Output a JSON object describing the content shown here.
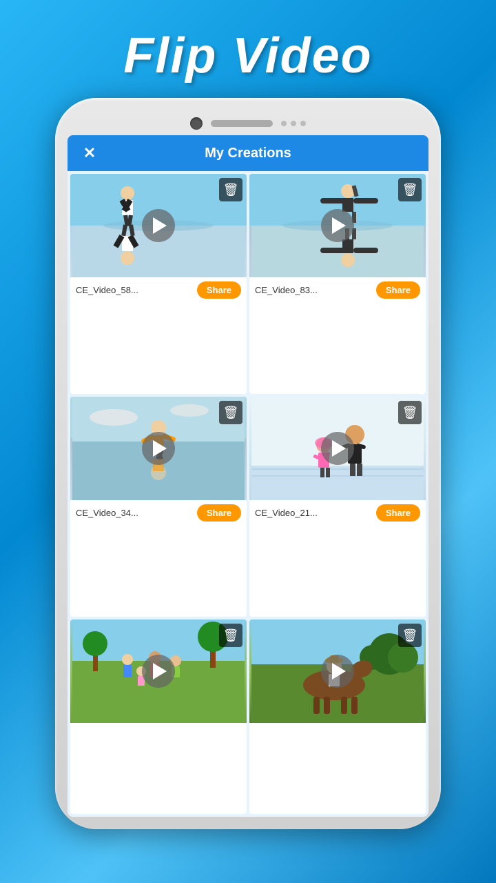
{
  "app": {
    "title": "Flip Video"
  },
  "header": {
    "close_label": "✕",
    "title": "My Creations"
  },
  "videos": [
    {
      "id": "v1",
      "name": "CE_Video_58...",
      "share_label": "Share",
      "thumb_type": "skate1"
    },
    {
      "id": "v2",
      "name": "CE_Video_83...",
      "share_label": "Share",
      "thumb_type": "skate2"
    },
    {
      "id": "v3",
      "name": "CE_Video_34...",
      "share_label": "Share",
      "thumb_type": "trick"
    },
    {
      "id": "v4",
      "name": "CE_Video_21...",
      "share_label": "Share",
      "thumb_type": "skate3"
    },
    {
      "id": "v5",
      "name": "",
      "share_label": "",
      "thumb_type": "park"
    },
    {
      "id": "v6",
      "name": "",
      "share_label": "",
      "thumb_type": "horse"
    }
  ],
  "icons": {
    "close": "✕",
    "trash": "🗑",
    "play": "▶"
  }
}
